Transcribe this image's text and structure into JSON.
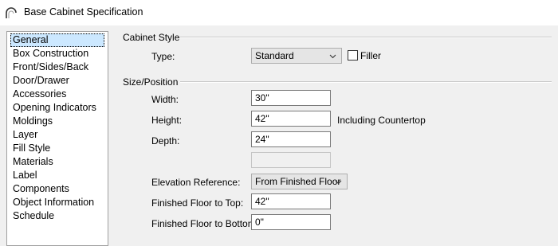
{
  "window": {
    "title": "Base Cabinet Specification"
  },
  "sidebar": {
    "items": [
      {
        "label": "General",
        "selected": true
      },
      {
        "label": "Box Construction"
      },
      {
        "label": "Front/Sides/Back"
      },
      {
        "label": "Door/Drawer"
      },
      {
        "label": "Accessories"
      },
      {
        "label": "Opening Indicators"
      },
      {
        "label": "Moldings"
      },
      {
        "label": "Layer"
      },
      {
        "label": "Fill Style"
      },
      {
        "label": "Materials"
      },
      {
        "label": "Label"
      },
      {
        "label": "Components"
      },
      {
        "label": "Object Information"
      },
      {
        "label": "Schedule"
      }
    ]
  },
  "cabinet_style": {
    "group_label": "Cabinet Style",
    "type_label": "Type:",
    "type_value": "Standard",
    "filler_label": "Filler",
    "filler_checked": false
  },
  "size_position": {
    "group_label": "Size/Position",
    "width_label": "Width:",
    "width_value": "30\"",
    "height_label": "Height:",
    "height_value": "42\"",
    "height_note": "Including Countertop",
    "depth_label": "Depth:",
    "depth_value": "24\"",
    "disabled_value": "",
    "elevation_label": "Elevation Reference:",
    "elevation_value": "From Finished Floor",
    "floor_to_top_label": "Finished Floor to Top:",
    "floor_to_top_value": "42\"",
    "floor_to_bottom_label": "Finished Floor to Bottom:",
    "floor_to_bottom_value": "0\""
  },
  "icons": {
    "app": "arch-icon",
    "dropdown": "chevron-down-icon"
  }
}
